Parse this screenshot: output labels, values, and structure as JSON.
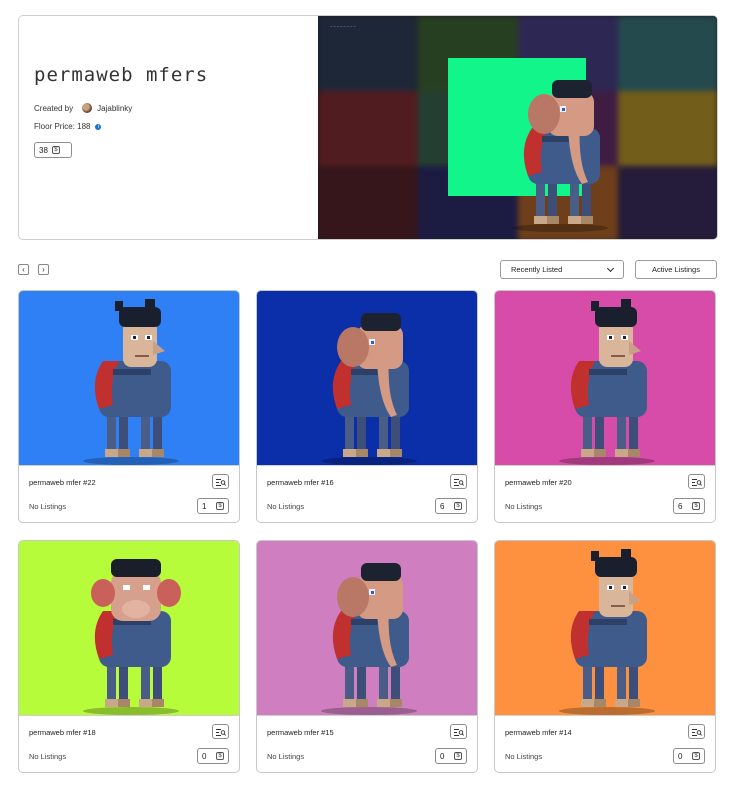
{
  "collection": {
    "title": "permaweb mfers",
    "created_by_label": "Created by",
    "creator": "Jajablinky",
    "floor_price_label": "Floor Price: 188",
    "item_count": "38",
    "currency_symbol": "$",
    "info_symbol": "i"
  },
  "banner": {
    "caption": "~~~~~~~~",
    "featured_bg": "#12f58b",
    "mosaic_colors": [
      "#2f3e55",
      "#3f6b2c",
      "#4a3f88",
      "#3a7e7e",
      "#8b2b2b",
      "#3a6b4a",
      "#6a2d6a",
      "#c8a020",
      "#5a2020",
      "#2a2a6a",
      "#c06a20",
      "#3a2a5a"
    ]
  },
  "toolbar": {
    "prev_symbol": "‹",
    "next_symbol": "›",
    "sort_label": "Recently Listed",
    "filter_label": "Active Listings"
  },
  "cards": [
    {
      "name": "permaweb mfer #22",
      "status": "No Listings",
      "count": "1",
      "bg": "#2f80f5",
      "creature": "mfer"
    },
    {
      "name": "permaweb mfer #16",
      "status": "No Listings",
      "count": "6",
      "bg": "#0b2fa8",
      "creature": "elephant"
    },
    {
      "name": "permaweb mfer #20",
      "status": "No Listings",
      "count": "6",
      "bg": "#d84ca9",
      "creature": "mfer"
    },
    {
      "name": "permaweb mfer #18",
      "status": "No Listings",
      "count": "0",
      "bg": "#b7fc3a",
      "creature": "monkey"
    },
    {
      "name": "permaweb mfer #15",
      "status": "No Listings",
      "count": "0",
      "bg": "#cf7fbf",
      "creature": "elephant"
    },
    {
      "name": "permaweb mfer #14",
      "status": "No Listings",
      "count": "0",
      "bg": "#fd913f",
      "creature": "mfer"
    }
  ]
}
